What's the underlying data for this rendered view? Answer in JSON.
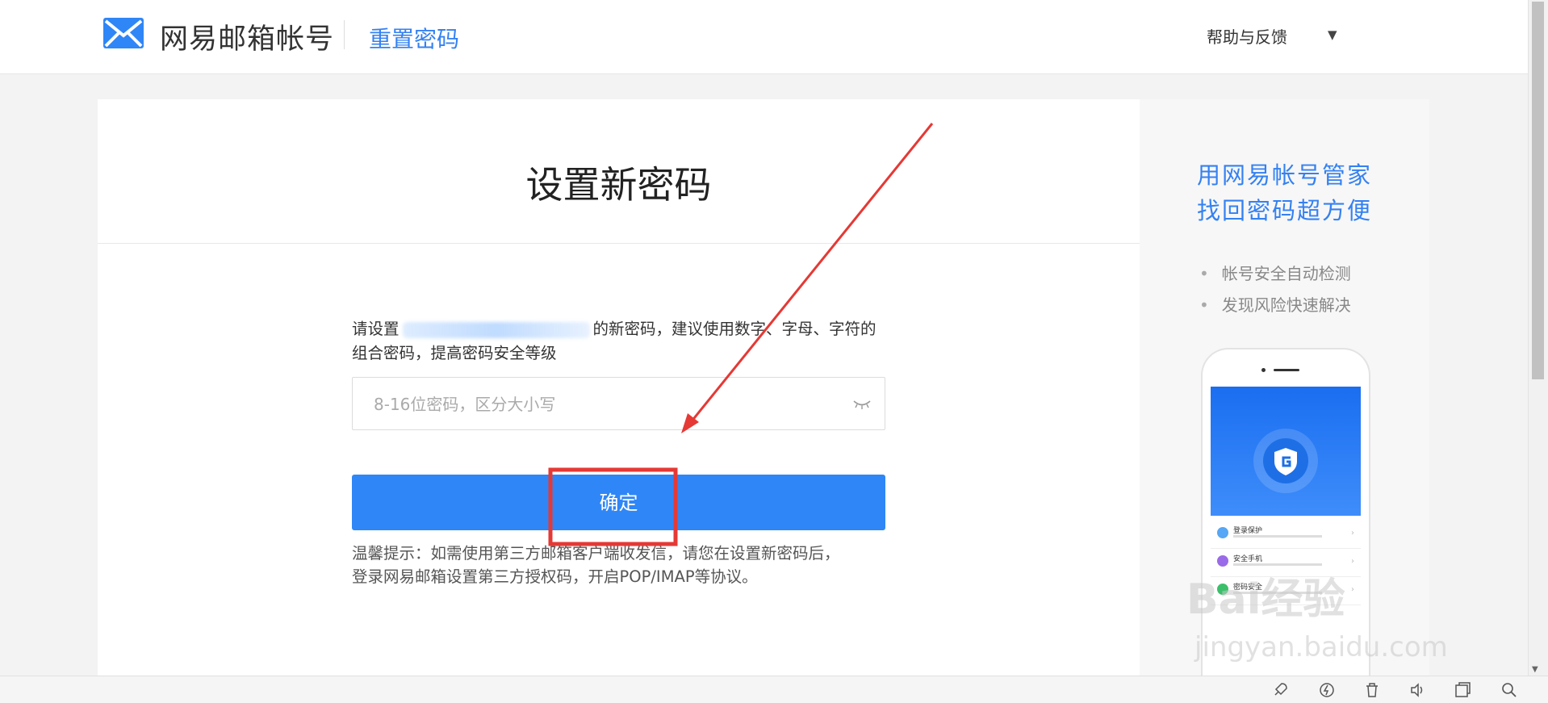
{
  "header": {
    "logo_text": "网易邮箱帐号",
    "subtitle": "重置密码",
    "help": "帮助与反馈",
    "help_caret": "▼",
    "brand_color": "#3481f2"
  },
  "main": {
    "title": "设置新密码",
    "desc_prefix": "请设置",
    "desc_suffix": "的新密码，建议使用数字、字母、字符的组合密码，提高密码安全等级",
    "password": {
      "value": "",
      "placeholder": "8-16位密码，区分大小写",
      "visibility_icon": "eye-closed-icon"
    },
    "confirm_label": "确定",
    "confirm_color": "#2f86f6",
    "tips_line1": "温馨提示：如需使用第三方邮箱客户端收发信，请您在设置新密码后，",
    "tips_line2": "登录网易邮箱设置第三方授权码，开启POP/IMAP等协议。"
  },
  "side": {
    "title_line1": "用网易帐号管家",
    "title_line2": "找回密码超方便",
    "features": [
      "帐号安全自动检测",
      "发现风险快速解决"
    ],
    "phone_rows": [
      "登录保护",
      "安全手机",
      "密码安全"
    ]
  },
  "watermark": {
    "line1": "Bai经验",
    "line2": "jingyan.baidu.com"
  },
  "statusbar": {
    "icons": [
      "rocket-icon",
      "speed-icon",
      "trash-icon",
      "speaker-icon",
      "window-icon",
      "search-icon"
    ]
  },
  "annotation": {
    "arrow_color": "#e53935",
    "box_color": "#e53935"
  }
}
